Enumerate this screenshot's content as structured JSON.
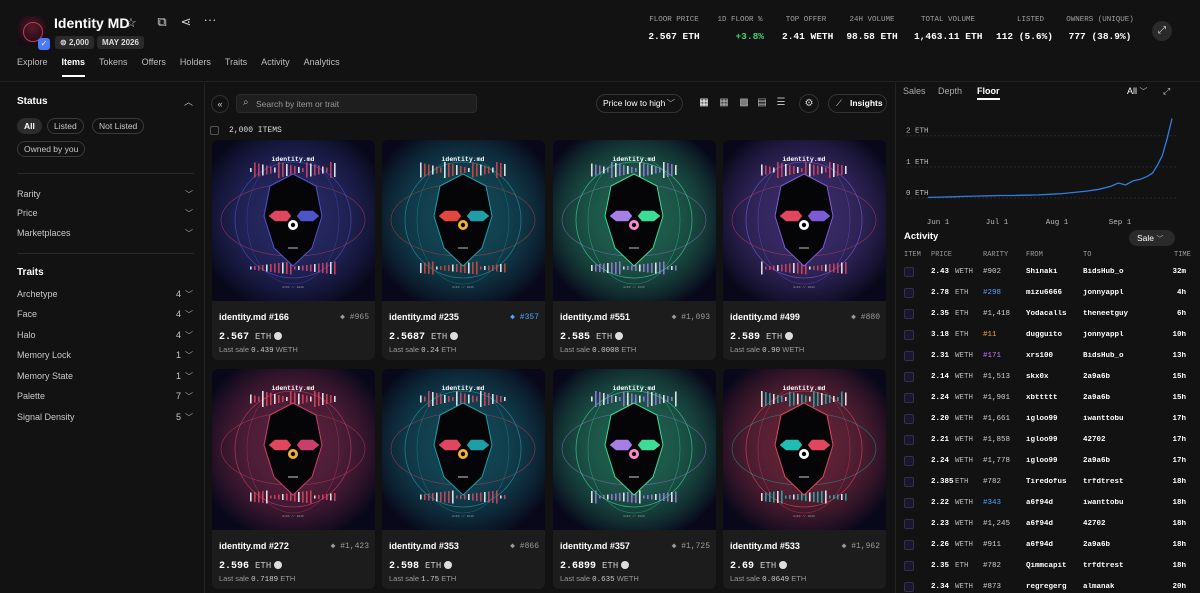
{
  "collection": {
    "name": "Identity MD",
    "items_pill": "2,000",
    "date_pill": "MAY 2026"
  },
  "nav_tabs": [
    "Explore",
    "Items",
    "Tokens",
    "Offers",
    "Holders",
    "Traits",
    "Activity",
    "Analytics"
  ],
  "active_tab": "Items",
  "stats": [
    {
      "label": "FLOOR PRICE",
      "value": "2.567 ETH"
    },
    {
      "label": "1D FLOOR %",
      "value": "+3.8%"
    },
    {
      "label": "TOP OFFER",
      "value": "2.41 WETH"
    },
    {
      "label": "24H VOLUME",
      "value": "98.58 ETH"
    },
    {
      "label": "TOTAL VOLUME",
      "value": "1,463.11 ETH"
    },
    {
      "label": "LISTED",
      "value": "112 (5.6%)"
    },
    {
      "label": "OWNERS (UNIQUE)",
      "value": "777 (38.9%)"
    }
  ],
  "filters": {
    "status_title": "Status",
    "status_chips": [
      "All",
      "Listed",
      "Not Listed",
      "Owned by you"
    ],
    "groups": [
      "Rarity",
      "Price",
      "Marketplaces"
    ],
    "traits_title": "Traits",
    "traits": [
      {
        "name": "Archetype",
        "count": "4"
      },
      {
        "name": "Face",
        "count": "4"
      },
      {
        "name": "Halo",
        "count": "4"
      },
      {
        "name": "Memory Lock",
        "count": "1"
      },
      {
        "name": "Memory State",
        "count": "1"
      },
      {
        "name": "Palette",
        "count": "7"
      },
      {
        "name": "Signal Density",
        "count": "5"
      }
    ]
  },
  "toolbar": {
    "search_placeholder": "Search by item or trait",
    "sort_label": "Price low to high",
    "insights_label": "Insights",
    "item_count": "2,000 ITEMS"
  },
  "icons": {
    "collapse": "collapse-sidebar-icon",
    "search": "search-icon",
    "star": "star-icon",
    "copy": "copy-icon",
    "share": "share-icon",
    "more": "more-icon",
    "fullscreen": "fullscreen-icon",
    "settings": "gear-icon",
    "insights": "chart-icon"
  },
  "art": {
    "title": "identity.md",
    "footer": "0xID // 2026"
  },
  "cards": [
    {
      "name": "identity.md #166",
      "rank": "#965",
      "rank_color": "gray",
      "price": "2.567",
      "unit": "ETH",
      "last_sale": "0.439",
      "last_unit": "WETH",
      "accent": "#e0465e",
      "halo": "#4e54c8",
      "eye": "#ffffff"
    },
    {
      "name": "identity.md #235",
      "rank": "#357",
      "rank_color": "blue",
      "price": "2.5687",
      "unit": "ETH",
      "last_sale": "0.24",
      "last_unit": "ETH",
      "accent": "#e2463e",
      "halo": "#1f9ea8",
      "eye": "#f7b32b"
    },
    {
      "name": "identity.md #551",
      "rank": "#1,093",
      "rank_color": "gray",
      "price": "2.585",
      "unit": "ETH",
      "last_sale": "0.0008",
      "last_unit": "ETH",
      "accent": "#a77ee6",
      "halo": "#3ddc97",
      "eye": "#ff8ad0"
    },
    {
      "name": "identity.md #499",
      "rank": "#880",
      "rank_color": "gray",
      "price": "2.589",
      "unit": "ETH",
      "last_sale": "0.90",
      "last_unit": "WETH",
      "accent": "#e0465e",
      "halo": "#7d5bd6",
      "eye": "#ffffff"
    },
    {
      "name": "identity.md #272",
      "rank": "#1,423",
      "rank_color": "gray",
      "price": "2.596",
      "unit": "ETH",
      "last_sale": "0.7189",
      "last_unit": "ETH",
      "accent": "#e0465e",
      "halo": "#c8406a",
      "eye": "#f7b32b"
    },
    {
      "name": "identity.md #353",
      "rank": "#866",
      "rank_color": "gray",
      "price": "2.598",
      "unit": "ETH",
      "last_sale": "1.75",
      "last_unit": "ETH",
      "accent": "#e0465e",
      "halo": "#1f9ea8",
      "eye": "#f7b32b"
    },
    {
      "name": "identity.md #357",
      "rank": "#1,725",
      "rank_color": "gray",
      "price": "2.6899",
      "unit": "ETH",
      "last_sale": "0.635",
      "last_unit": "WETH",
      "accent": "#a77ee6",
      "halo": "#3ddc97",
      "eye": "#ff8ad0"
    },
    {
      "name": "identity.md #533",
      "rank": "#1,962",
      "rank_color": "gray",
      "price": "2.69",
      "unit": "ETH",
      "last_sale": "0.0649",
      "last_unit": "ETH",
      "accent": "#1fbdb3",
      "halo": "#e0465e",
      "eye": "#ffffff"
    }
  ],
  "right_panel": {
    "tabs": [
      "Sales",
      "Depth",
      "Floor"
    ],
    "active_tab": "Floor",
    "range": "All",
    "activity_title": "Activity",
    "activity_filter": "Sale",
    "columns": [
      "ITEM",
      "PRICE",
      "RARITY",
      "FROM",
      "TO",
      "TIME"
    ]
  },
  "chart_data": {
    "type": "line",
    "y_ticks": [
      "2 ETH",
      "1 ETH",
      "0 ETH"
    ],
    "ylim": [
      0,
      2.6
    ],
    "x_ticks": [
      "Jun 1",
      "Jul 1",
      "Aug 1",
      "Sep 1"
    ],
    "color": "#2f7fe0",
    "points": [
      [
        0.0,
        0.02
      ],
      [
        0.05,
        0.03
      ],
      [
        0.1,
        0.04
      ],
      [
        0.15,
        0.05
      ],
      [
        0.2,
        0.06
      ],
      [
        0.25,
        0.07
      ],
      [
        0.3,
        0.08
      ],
      [
        0.35,
        0.08
      ],
      [
        0.4,
        0.09
      ],
      [
        0.45,
        0.1
      ],
      [
        0.5,
        0.12
      ],
      [
        0.55,
        0.14
      ],
      [
        0.6,
        0.18
      ],
      [
        0.65,
        0.22
      ],
      [
        0.7,
        0.28
      ],
      [
        0.75,
        0.38
      ],
      [
        0.78,
        0.48
      ],
      [
        0.81,
        0.42
      ],
      [
        0.84,
        0.55
      ],
      [
        0.87,
        0.6
      ],
      [
        0.9,
        0.7
      ],
      [
        0.92,
        0.8
      ],
      [
        0.94,
        1.05
      ],
      [
        0.96,
        1.35
      ],
      [
        0.98,
        1.9
      ],
      [
        1.0,
        2.55
      ]
    ]
  },
  "activity": [
    {
      "price": "2.43",
      "unit": "WETH",
      "rarity": "#902",
      "rarity_color": "gray",
      "from": "Shinaki",
      "to": "BidsHub_o",
      "time": "32m"
    },
    {
      "price": "2.78",
      "unit": "ETH",
      "rarity": "#298",
      "rarity_color": "blue",
      "from": "mizu6666",
      "to": "jonnyappl",
      "time": "4h"
    },
    {
      "price": "2.35",
      "unit": "ETH",
      "rarity": "#1,418",
      "rarity_color": "gray",
      "from": "Yodacalls",
      "to": "theneetguy",
      "time": "6h"
    },
    {
      "price": "3.18",
      "unit": "ETH",
      "rarity": "#11",
      "rarity_color": "orange",
      "from": "dugguito",
      "to": "jonnyappl",
      "time": "10h"
    },
    {
      "price": "2.31",
      "unit": "WETH",
      "rarity": "#171",
      "rarity_color": "purple",
      "from": "xrs100",
      "to": "BidsHub_o",
      "time": "13h"
    },
    {
      "price": "2.14",
      "unit": "WETH",
      "rarity": "#1,513",
      "rarity_color": "gray",
      "from": "skx0x",
      "to": "2a9a6b",
      "time": "15h"
    },
    {
      "price": "2.24",
      "unit": "WETH",
      "rarity": "#1,901",
      "rarity_color": "gray",
      "from": "xbttttt",
      "to": "2a9a6b",
      "time": "15h"
    },
    {
      "price": "2.20",
      "unit": "WETH",
      "rarity": "#1,661",
      "rarity_color": "gray",
      "from": "igloo99",
      "to": "iwanttobu",
      "time": "17h"
    },
    {
      "price": "2.21",
      "unit": "WETH",
      "rarity": "#1,858",
      "rarity_color": "gray",
      "from": "igloo99",
      "to": "42702",
      "time": "17h"
    },
    {
      "price": "2.24",
      "unit": "WETH",
      "rarity": "#1,778",
      "rarity_color": "gray",
      "from": "igloo99",
      "to": "2a9a6b",
      "time": "17h"
    },
    {
      "price": "2.385",
      "unit": "ETH",
      "rarity": "#782",
      "rarity_color": "gray",
      "from": "Tiredofus",
      "to": "trfdtrest",
      "time": "18h"
    },
    {
      "price": "2.22",
      "unit": "WETH",
      "rarity": "#343",
      "rarity_color": "blue",
      "from": "a6f94d",
      "to": "iwanttobu",
      "time": "18h"
    },
    {
      "price": "2.23",
      "unit": "WETH",
      "rarity": "#1,245",
      "rarity_color": "gray",
      "from": "a6f94d",
      "to": "42702",
      "time": "18h"
    },
    {
      "price": "2.26",
      "unit": "WETH",
      "rarity": "#911",
      "rarity_color": "gray",
      "from": "a6f94d",
      "to": "2a9a6b",
      "time": "18h"
    },
    {
      "price": "2.35",
      "unit": "ETH",
      "rarity": "#782",
      "rarity_color": "gray",
      "from": "Qimmcapit",
      "to": "trfdtrest",
      "time": "18h"
    },
    {
      "price": "2.34",
      "unit": "WETH",
      "rarity": "#873",
      "rarity_color": "gray",
      "from": "regregerg",
      "to": "almanak",
      "time": "20h"
    }
  ]
}
